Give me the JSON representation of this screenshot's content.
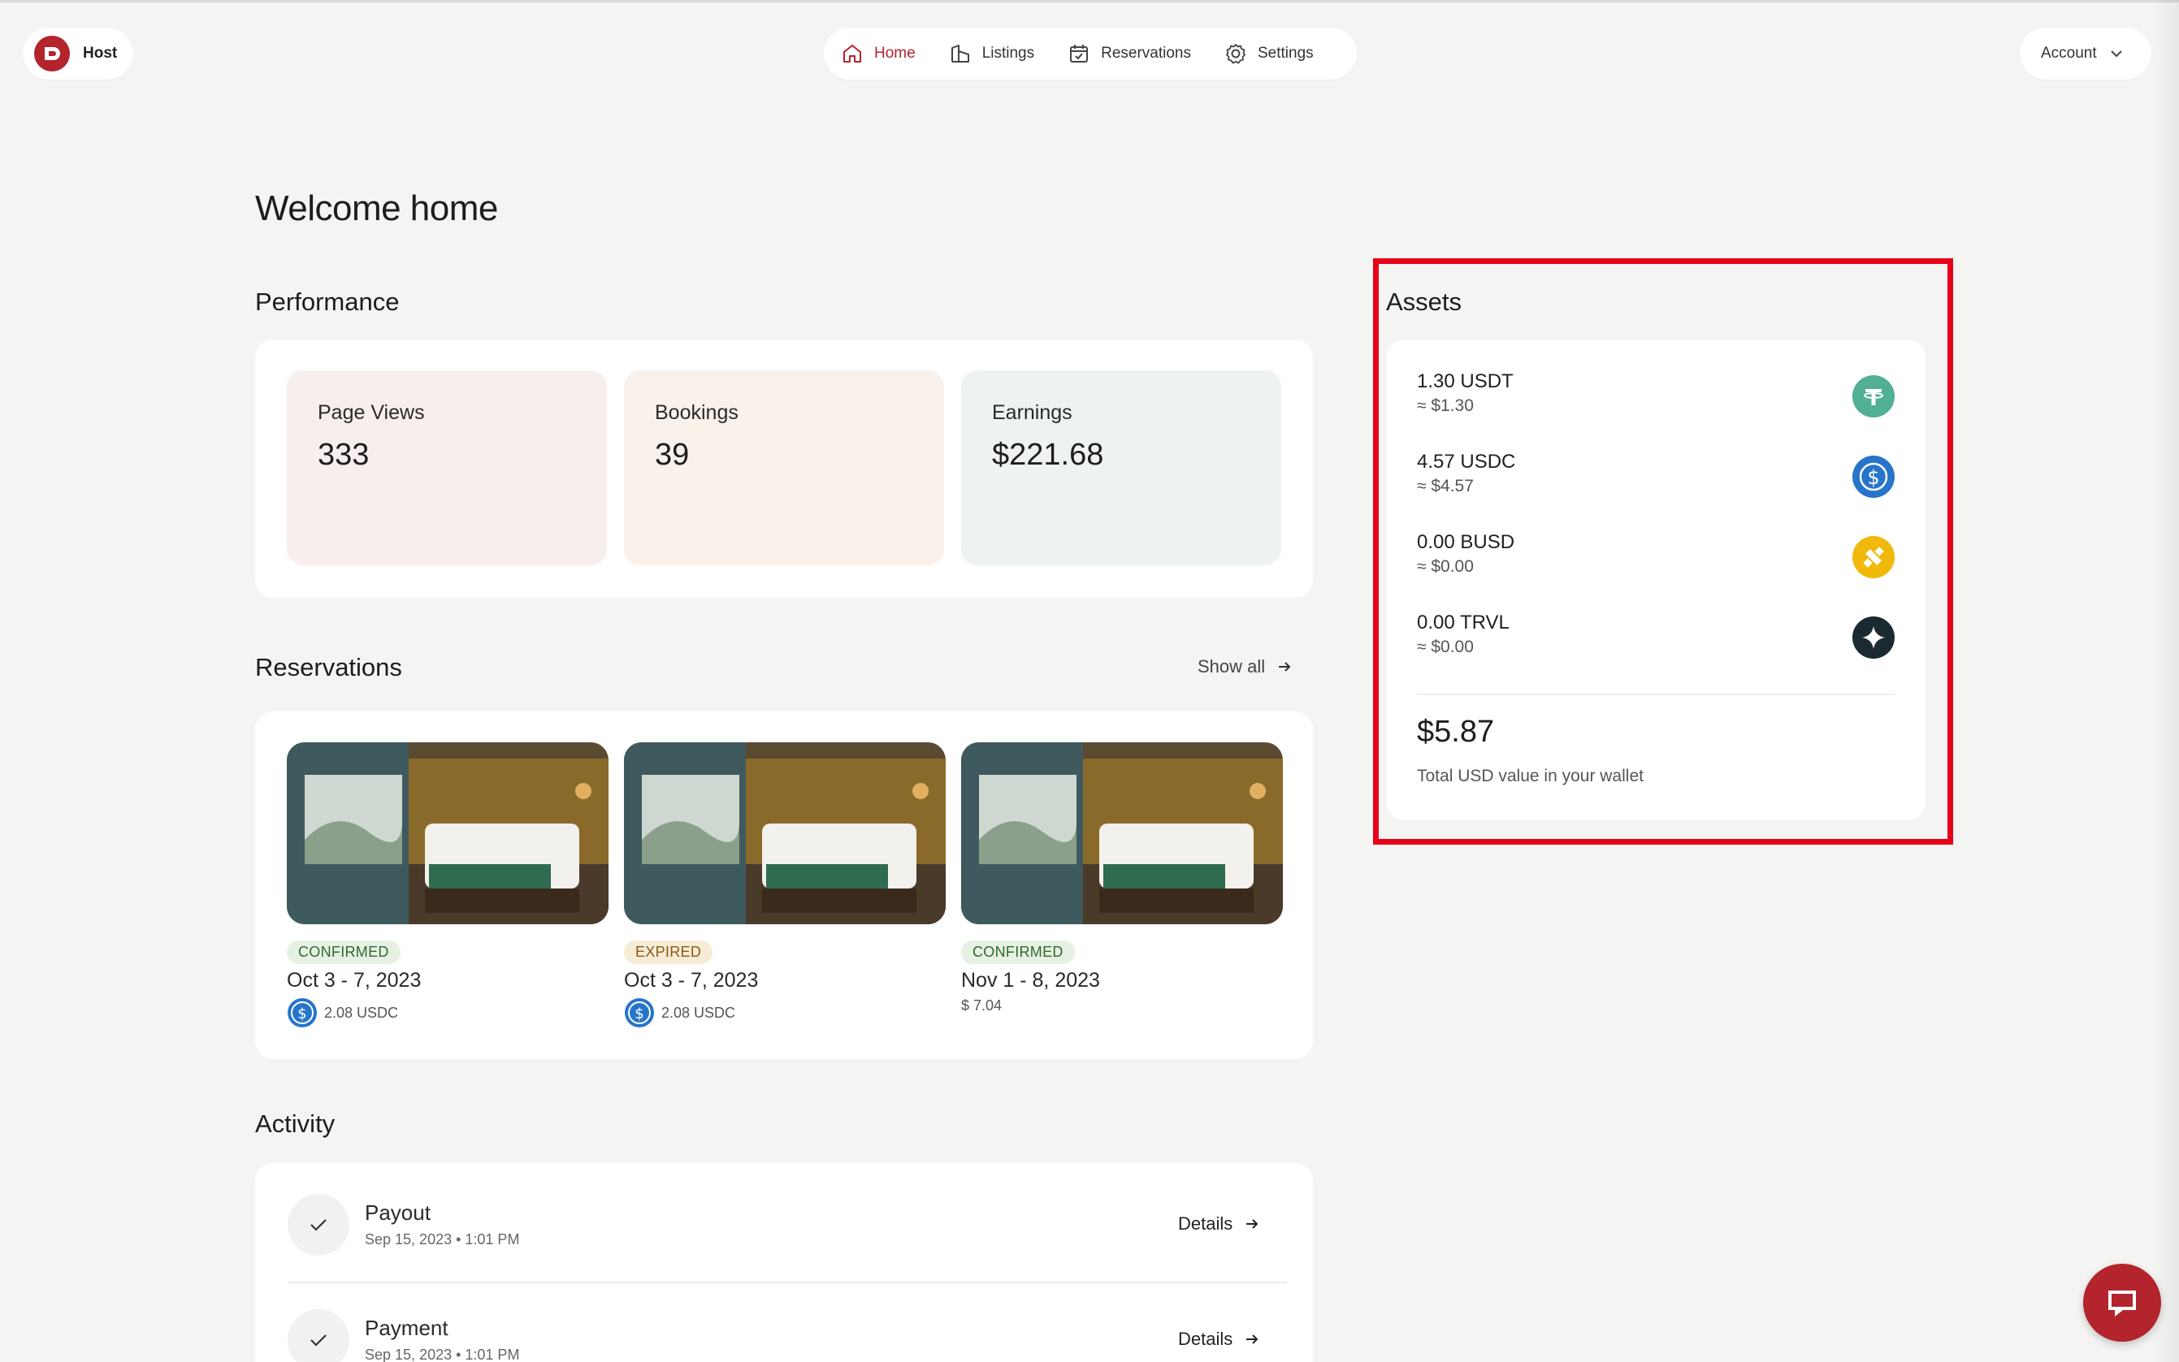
{
  "header": {
    "host_label": "Host",
    "nav": [
      {
        "label": "Home",
        "icon": "home-icon",
        "active": true
      },
      {
        "label": "Listings",
        "icon": "listings-icon"
      },
      {
        "label": "Reservations",
        "icon": "calendar-icon"
      },
      {
        "label": "Settings",
        "icon": "gear-icon"
      }
    ],
    "account_label": "Account"
  },
  "page": {
    "title": "Welcome home"
  },
  "performance": {
    "title": "Performance",
    "tiles": [
      {
        "label": "Page Views",
        "value": "333",
        "color": "#f9eeee"
      },
      {
        "label": "Bookings",
        "value": "39",
        "color": "#faf1eb"
      },
      {
        "label": "Earnings",
        "value": "$221.68",
        "color": "#eef3ef"
      }
    ]
  },
  "reservations": {
    "title": "Reservations",
    "show_all": "Show all",
    "items": [
      {
        "status": "CONFIRMED",
        "dates": "Oct 3 - 7, 2023",
        "price": "2.08 USDC",
        "token": "usdc"
      },
      {
        "status": "EXPIRED",
        "dates": "Oct 3 - 7, 2023",
        "price": "2.08 USDC",
        "token": "usdc"
      },
      {
        "status": "CONFIRMED",
        "dates": "Nov 1 - 8, 2023",
        "price": "$ 7.04",
        "token": "none"
      }
    ]
  },
  "assets": {
    "title": "Assets",
    "items": [
      {
        "amount": "1.30 USDT",
        "usd": "≈ $1.30",
        "icon": "usdt-icon",
        "color": "#50af95"
      },
      {
        "amount": "4.57 USDC",
        "usd": "≈ $4.57",
        "icon": "usdc-icon",
        "color": "#2775ca"
      },
      {
        "amount": "0.00 BUSD",
        "usd": "≈ $0.00",
        "icon": "busd-icon",
        "color": "#f0b90b"
      },
      {
        "amount": "0.00 TRVL",
        "usd": "≈ $0.00",
        "icon": "trvl-icon",
        "color": "#1b2a30"
      }
    ],
    "total": "$5.87",
    "total_label": "Total USD value in your wallet"
  },
  "activity": {
    "title": "Activity",
    "items": [
      {
        "title": "Payout",
        "time": "Sep 15, 2023 • 1:01 PM",
        "details": "Details"
      },
      {
        "title": "Payment",
        "time": "Sep 15, 2023 • 1:01 PM",
        "details": "Details"
      }
    ]
  },
  "colors": {
    "brand": "#b3242d",
    "highlight": "#e8001a"
  }
}
